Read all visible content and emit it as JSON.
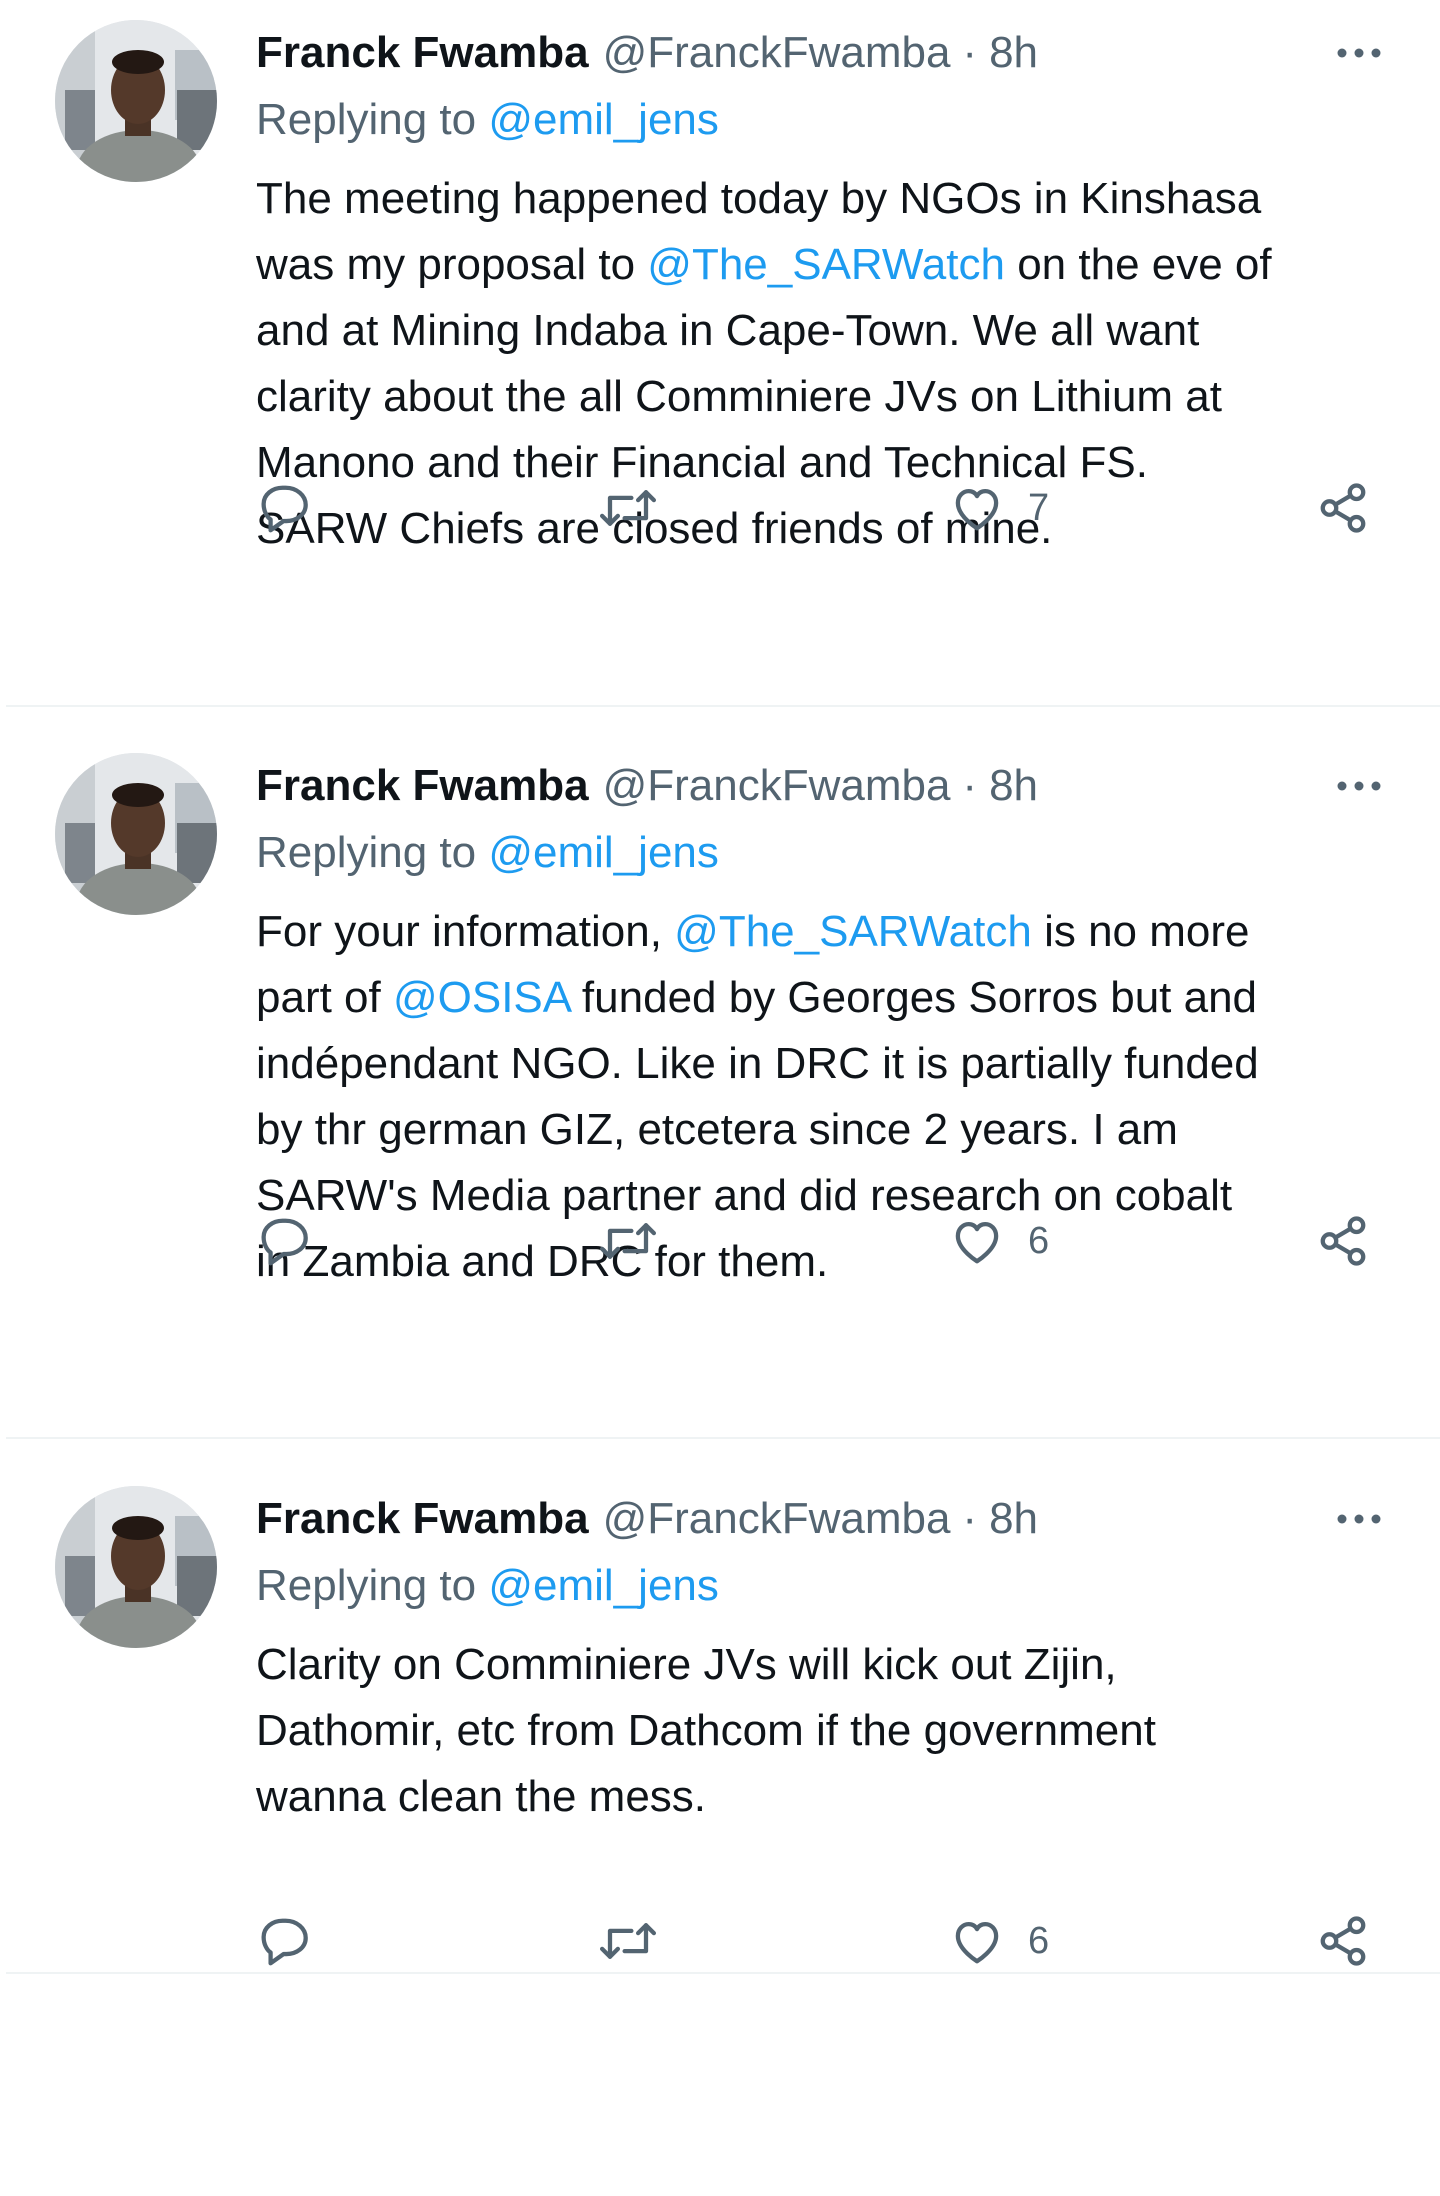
{
  "tweets": [
    {
      "name": "Franck Fwamba",
      "handle": "@FranckFwamba",
      "separator": "·",
      "time": "8h",
      "replying_prefix": "Replying to ",
      "replying_to": "@emil_jens",
      "lines": [
        {
          "a": "The meeting happened today by NGOs in Kinshasa",
          "m": "",
          "b": ""
        },
        {
          "a": "was my proposal to ",
          "m": "@The_SARWatch",
          "b": " on the eve of"
        },
        {
          "a": "and at Mining Indaba in Cape-Town. We all want",
          "m": "",
          "b": ""
        },
        {
          "a": "clarity about the all Comminiere JVs on Lithium at",
          "m": "",
          "b": ""
        },
        {
          "a": "Manono and their Financial and Technical FS.",
          "m": "",
          "b": ""
        },
        {
          "a": "SARW Chiefs are closed friends of mine.",
          "m": "",
          "b": ""
        }
      ],
      "likes": "7"
    },
    {
      "name": "Franck Fwamba",
      "handle": "@FranckFwamba",
      "separator": "·",
      "time": "8h",
      "replying_prefix": "Replying to ",
      "replying_to": "@emil_jens",
      "lines": [
        {
          "a": "For your information, ",
          "m": "@The_SARWatch",
          "b": " is no more"
        },
        {
          "a": "part of ",
          "m": "@OSISA",
          "b": " funded by Georges Sorros but and"
        },
        {
          "a": "indépendant NGO. Like in DRC it is partially funded",
          "m": "",
          "b": ""
        },
        {
          "a": "by thr german GIZ, etcetera since 2 years. I am",
          "m": "",
          "b": ""
        },
        {
          "a": "SARW's Media partner and did research on cobalt",
          "m": "",
          "b": ""
        },
        {
          "a": "in Zambia and DRC for them.",
          "m": "",
          "b": ""
        }
      ],
      "likes": "6"
    },
    {
      "name": "Franck Fwamba",
      "handle": "@FranckFwamba",
      "separator": "·",
      "time": "8h",
      "replying_prefix": "Replying to ",
      "replying_to": "@emil_jens",
      "lines": [
        {
          "a": "Clarity on Comminiere JVs will kick out Zijin,",
          "m": "",
          "b": ""
        },
        {
          "a": "Dathomir, etc from Dathcom if the government",
          "m": "",
          "b": ""
        },
        {
          "a": "wanna clean the mess.",
          "m": "",
          "b": ""
        }
      ],
      "likes": "6"
    }
  ],
  "icons": {
    "reply": "reply-icon",
    "retweet": "retweet-icon",
    "like": "heart-icon",
    "share": "share-icon",
    "more": "more-icon"
  },
  "colors": {
    "text": "#0f1419",
    "secondary": "#536471",
    "link": "#1d9bf0",
    "divider": "#eff3f4"
  }
}
